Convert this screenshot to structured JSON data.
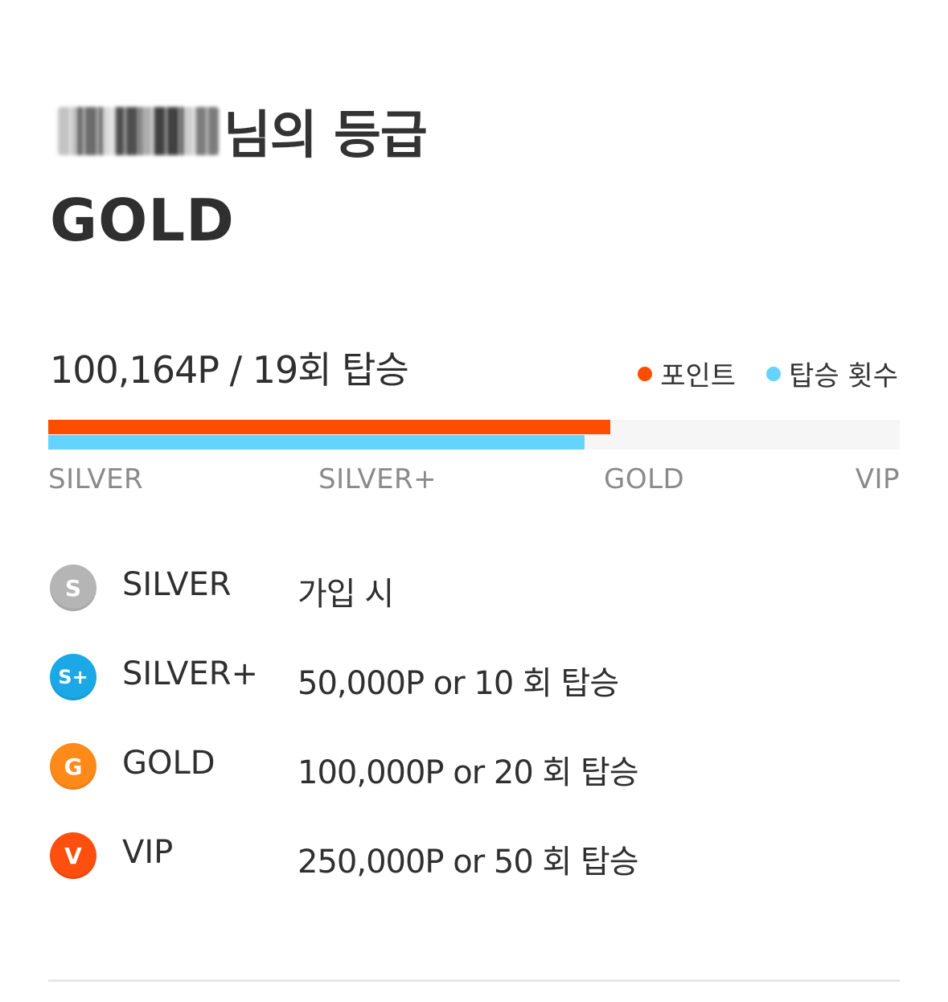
{
  "header": {
    "title_suffix": "님의 등급",
    "current_grade": "GOLD"
  },
  "summary": {
    "text": "100,164P / 19회 탑승"
  },
  "legend": {
    "points_label": "포인트",
    "rides_label": "탑승 횟수",
    "points_color": "#ff4d00",
    "rides_color": "#66d3ff"
  },
  "progress": {
    "points_fraction": 0.66,
    "rides_fraction": 0.63
  },
  "ticks": [
    "SILVER",
    "SILVER+",
    "GOLD",
    "VIP"
  ],
  "grades": [
    {
      "badge": "S",
      "color": "#b5b5b5",
      "name": "SILVER",
      "requirement": "가입 시"
    },
    {
      "badge": "S+",
      "color": "#1aa9e6",
      "name": "SILVER+",
      "requirement": "50,000P or 10 회 탑승"
    },
    {
      "badge": "G",
      "color": "#ff8a1a",
      "name": "GOLD",
      "requirement": "100,000P or 20 회 탑승"
    },
    {
      "badge": "V",
      "color": "#ff4f0f",
      "name": "VIP",
      "requirement": "250,000P or 50 회 탑승"
    }
  ]
}
